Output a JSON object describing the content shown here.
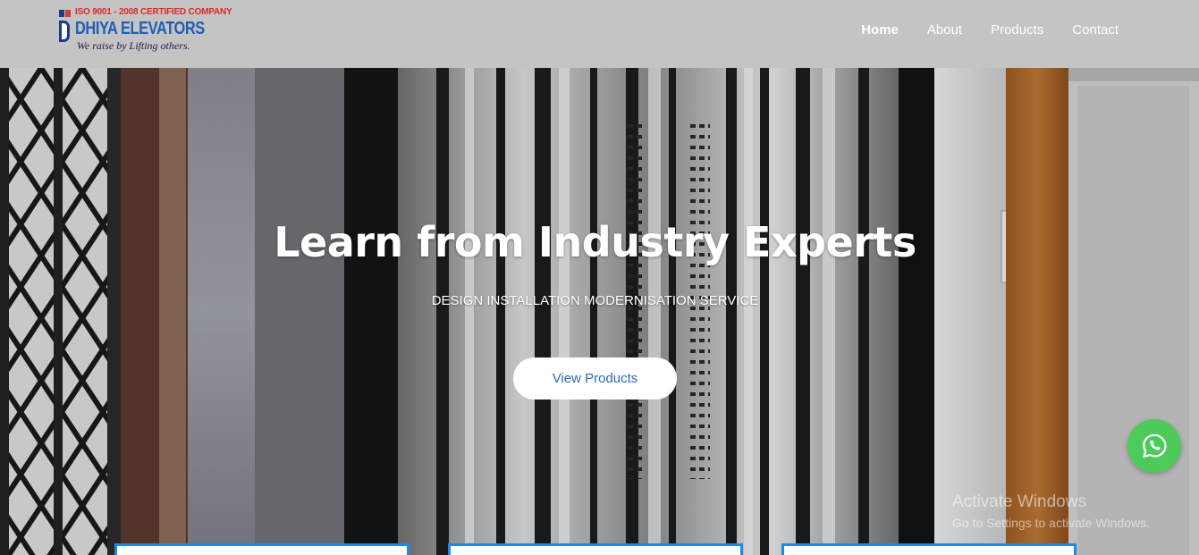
{
  "brand": {
    "certification": "ISO 9001 - 2008 CERTIFIED COMPANY",
    "name": "DHIYA ELEVATORS",
    "tagline": "We raise by Lifting others.",
    "colors": {
      "primary": "#1f5fb5",
      "accent": "#d22c2c"
    }
  },
  "nav": {
    "items": [
      {
        "label": "Home",
        "active": true
      },
      {
        "label": "About"
      },
      {
        "label": "Products"
      },
      {
        "label": "Contact"
      }
    ]
  },
  "hero": {
    "title": "Learn from Industry Experts",
    "subtitle": "DESIGN INSTALLATION MODERNISATION SERVICE",
    "cta_label": "View Products"
  },
  "overlay": {
    "watermark_line1": "Activate Windows",
    "watermark_line2": "Go to Settings to activate Windows."
  },
  "whatsapp": {
    "icon": "whatsapp-icon",
    "color": "#4ccb5a"
  }
}
